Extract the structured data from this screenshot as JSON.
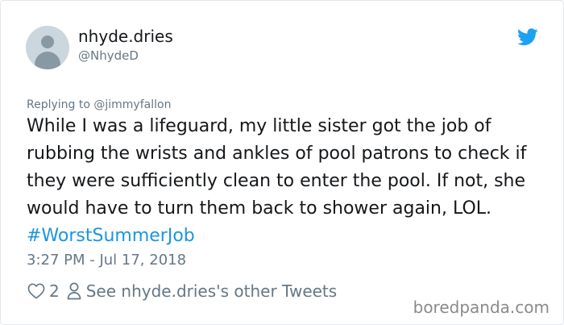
{
  "user": {
    "display_name": "nhyde.dries",
    "handle": "@NhydeD"
  },
  "tweet": {
    "replying_to": "Replying to @jimmyfallon",
    "text": "While I was a lifeguard, my little sister got the job of rubbing the wrists and ankles of pool patrons to check if they were sufficiently clean to enter the pool. If not, she would have to turn them back to shower again, LOL.",
    "hashtag": "#WorstSummerJob",
    "timestamp": "3:27 PM - Jul 17, 2018"
  },
  "actions": {
    "likes": "2",
    "other_tweets_label": "See nhyde.dries's other Tweets"
  },
  "watermark": "boredpanda.com",
  "icons": {
    "brand": "twitter-bird-icon",
    "like": "heart-icon",
    "profile": "person-icon"
  },
  "colors": {
    "link": "#1b95e0",
    "text": "#14171a",
    "muted": "#657786",
    "brand": "#1da1f2"
  }
}
